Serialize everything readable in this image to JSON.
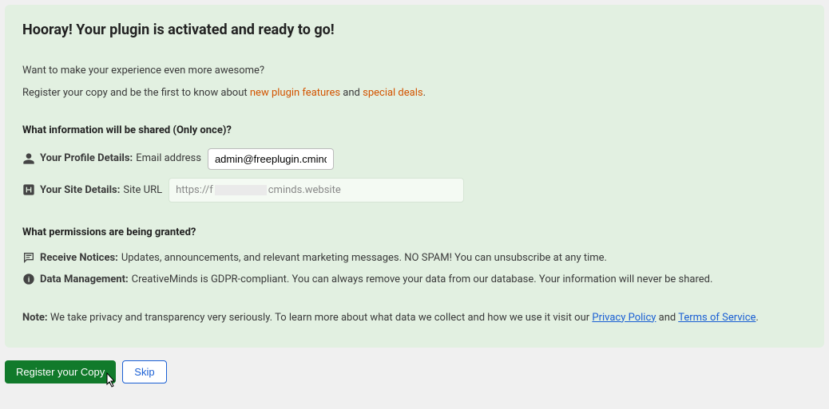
{
  "title": "Hooray! Your plugin is activated and ready to go!",
  "intro": {
    "line1": "Want to make your experience even more awesome?",
    "line2_pre": "Register your copy and be the first to know about ",
    "link1": "new plugin features",
    "mid": " and ",
    "link2": "special deals",
    "end": "."
  },
  "section_shared": "What information will be shared (Only once)?",
  "profile": {
    "label": "Your Profile Details:",
    "sub": "Email address",
    "value": "admin@freeplugin.cminds"
  },
  "site": {
    "label": "Your Site Details:",
    "sub": "Site URL",
    "value_pre": "https://f",
    "value_post": "cminds.website"
  },
  "section_perm": "What permissions are being granted?",
  "perm1": {
    "label": "Receive Notices:",
    "text": "Updates, announcements, and relevant marketing messages. NO SPAM! You can unsubscribe at any time."
  },
  "perm2": {
    "label": "Data Management:",
    "text": "CreativeMinds is GDPR-compliant. You can always remove your data from our database. Your information will never be shared."
  },
  "note": {
    "label": "Note:",
    "text": " We take privacy and transparency very seriously. To learn more about what data we collect and how we use it visit our ",
    "link1": "Privacy Policy",
    "mid": " and ",
    "link2": "Terms of Service",
    "end": "."
  },
  "buttons": {
    "register": "Register your Copy",
    "skip": "Skip"
  }
}
